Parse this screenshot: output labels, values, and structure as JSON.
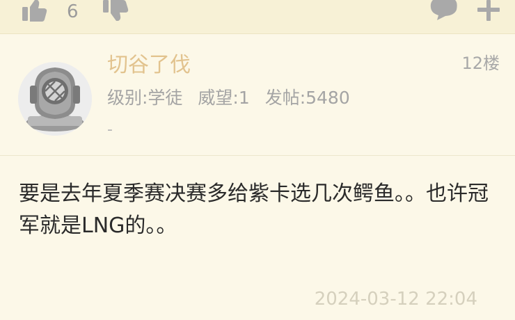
{
  "toolbar": {
    "like_count": "6",
    "icons": [
      "thumbs-up-icon",
      "thumbs-down-icon",
      "comment-icon",
      "plus-icon"
    ]
  },
  "post": {
    "username": "切谷了伐",
    "floor": "12楼",
    "stats": {
      "level": "级别:学徒",
      "prestige": "威望:1",
      "posts": "发帖:5480"
    },
    "signature": "-",
    "content": "要是去年夏季赛决赛多给紫卡选几次鳄鱼。。也许冠军就是LNG的。。",
    "timestamp": "2024-03-12 22:04"
  },
  "colors": {
    "background": "#fcf8e8",
    "username": "#e2c38e",
    "icon": "#a9a9a9"
  }
}
